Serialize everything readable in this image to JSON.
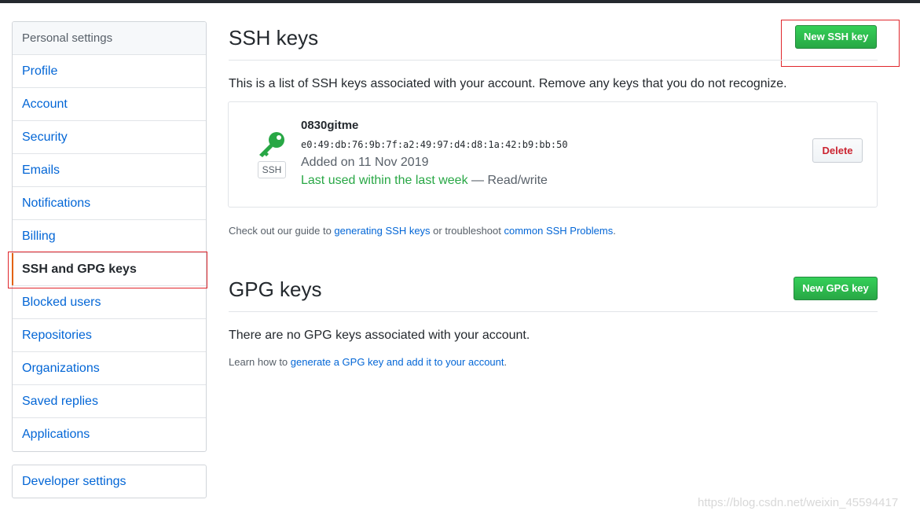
{
  "sidebar": {
    "heading": "Personal settings",
    "items": [
      {
        "label": "Profile"
      },
      {
        "label": "Account"
      },
      {
        "label": "Security"
      },
      {
        "label": "Emails"
      },
      {
        "label": "Notifications"
      },
      {
        "label": "Billing"
      },
      {
        "label": "SSH and GPG keys",
        "selected": true
      },
      {
        "label": "Blocked users"
      },
      {
        "label": "Repositories"
      },
      {
        "label": "Organizations"
      },
      {
        "label": "Saved replies"
      },
      {
        "label": "Applications"
      }
    ],
    "developer_settings": "Developer settings"
  },
  "ssh": {
    "title": "SSH keys",
    "new_button": "New SSH key",
    "description": "This is a list of SSH keys associated with your account. Remove any keys that you do not recognize.",
    "key": {
      "title": "0830gitme",
      "fingerprint": "e0:49:db:76:9b:7f:a2:49:97:d4:d8:1a:42:b9:bb:50",
      "added": "Added on 11 Nov 2019",
      "last_used": "Last used within the last week",
      "access": " — Read/write",
      "type_label": "SSH",
      "delete_button": "Delete"
    },
    "guide_prefix": "Check out our guide to ",
    "guide_link": "generating SSH keys",
    "guide_middle": " or troubleshoot ",
    "guide_link2": "common SSH Problems",
    "guide_suffix": "."
  },
  "gpg": {
    "title": "GPG keys",
    "new_button": "New GPG key",
    "empty_text": "There are no GPG keys associated with your account.",
    "learn_prefix": "Learn how to ",
    "learn_link": "generate a GPG key and add it to your account",
    "learn_suffix": "."
  },
  "watermark": "https://blog.csdn.net/weixin_45594417",
  "colors": {
    "accent_green": "#28a745",
    "link_blue": "#0366d6",
    "highlight_red": "#e0262c",
    "selected_marker": "#e36209",
    "danger": "#cb2431"
  }
}
